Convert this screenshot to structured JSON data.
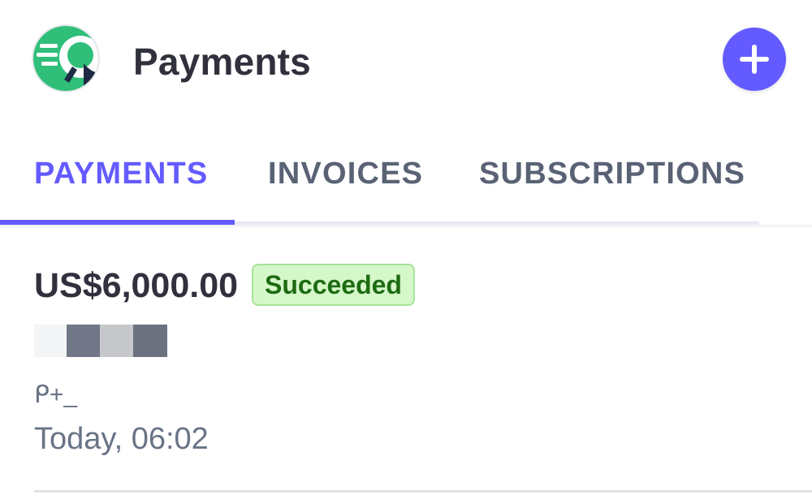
{
  "header": {
    "title": "Payments",
    "avatar_icon": "business-logo-icon",
    "add_icon": "plus-icon"
  },
  "tabs": [
    {
      "label": "PAYMENTS",
      "active": true
    },
    {
      "label": "INVOICES",
      "active": false
    },
    {
      "label": "SUBSCRIPTIONS",
      "active": false
    }
  ],
  "payments": [
    {
      "amount": "US$6,000.00",
      "status": "Succeeded",
      "glyph_text": "ᑭ+_",
      "timestamp": "Today, 06:02"
    }
  ],
  "colors": {
    "accent": "#635bff",
    "text_primary": "#30313d",
    "text_secondary": "#687385",
    "success_bg": "#d5f7c9",
    "success_text": "#1d6b12"
  }
}
